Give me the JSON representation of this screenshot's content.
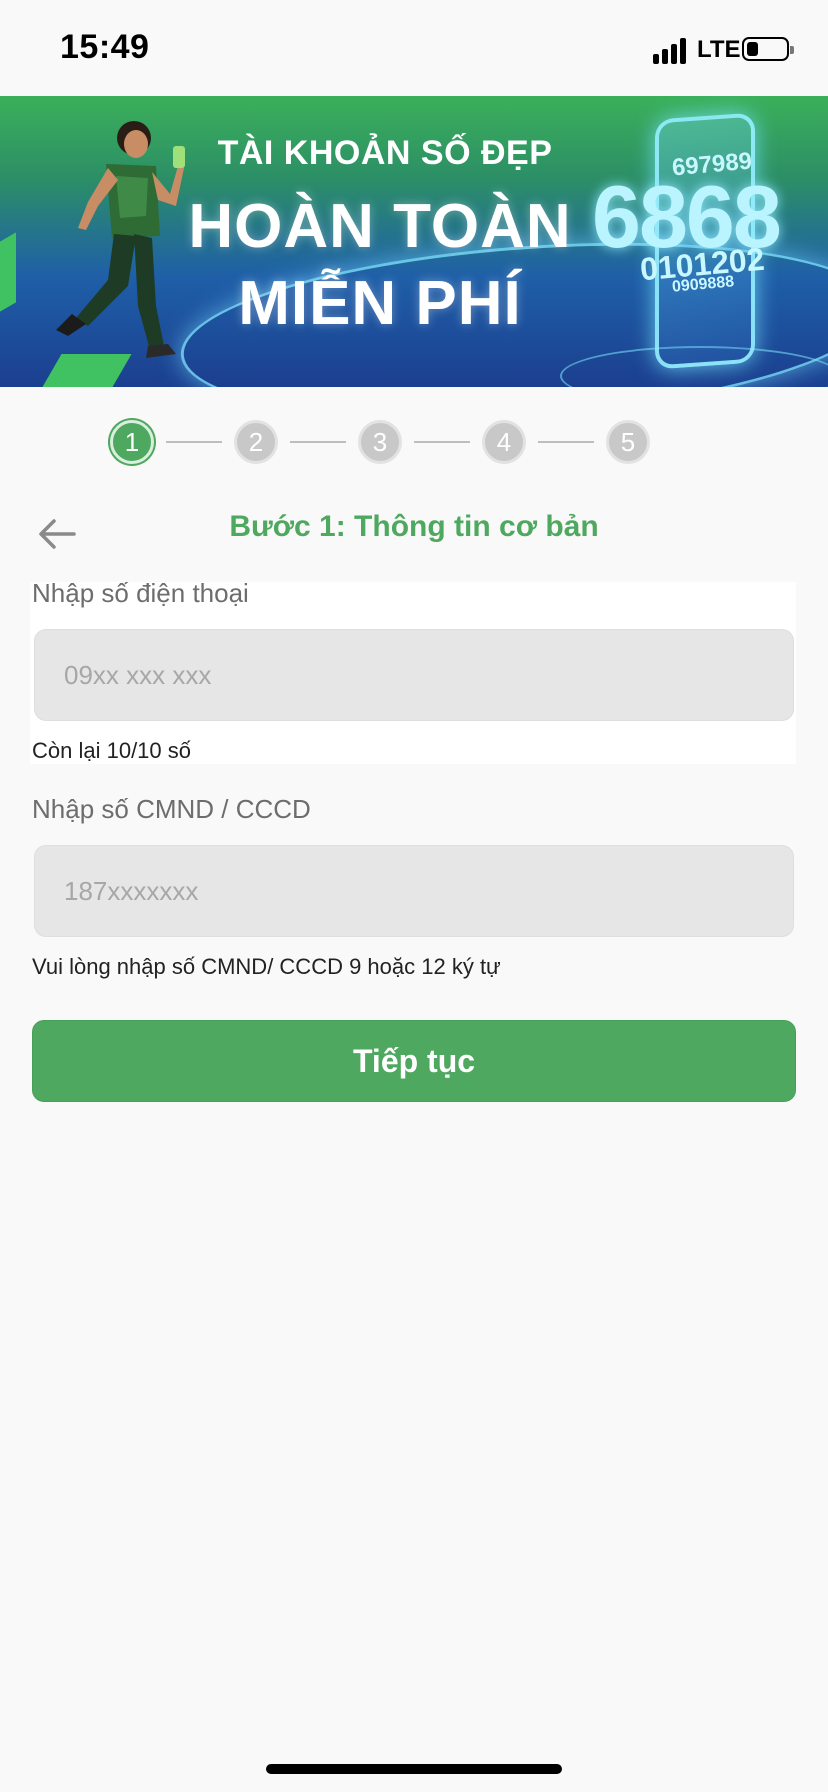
{
  "status_bar": {
    "time": "15:49",
    "network": "LTE",
    "icons": [
      "signal-icon",
      "battery-icon"
    ]
  },
  "banner": {
    "line1": "TÀI KHOẢN SỐ ĐẸP",
    "line2": "HOÀN TOÀN",
    "line3": "MIỄN PHÍ",
    "phone_numbers": [
      "6868",
      "697989",
      "0101202",
      "0909888"
    ]
  },
  "stepper": {
    "steps": [
      "1",
      "2",
      "3",
      "4",
      "5"
    ],
    "active_step": 1
  },
  "header": {
    "title": "Bước 1: Thông tin cơ bản",
    "back_icon": "arrow-left-icon"
  },
  "form": {
    "phone": {
      "label": "Nhập số điện thoại",
      "value": "",
      "placeholder": "09xx xxx xxx",
      "hint": "Còn lại 10/10 số"
    },
    "id_card": {
      "label": "Nhập số CMND / CCCD",
      "value": "",
      "placeholder": "187xxxxxxx",
      "hint": "Vui lòng nhập số CMND/ CCCD  9 hoặc 12 ký tự"
    },
    "submit_label": "Tiếp tục"
  },
  "colors": {
    "primary_green": "#4fa85f",
    "input_bg": "#e6e6e6",
    "step_inactive": "#c8c8c8"
  }
}
